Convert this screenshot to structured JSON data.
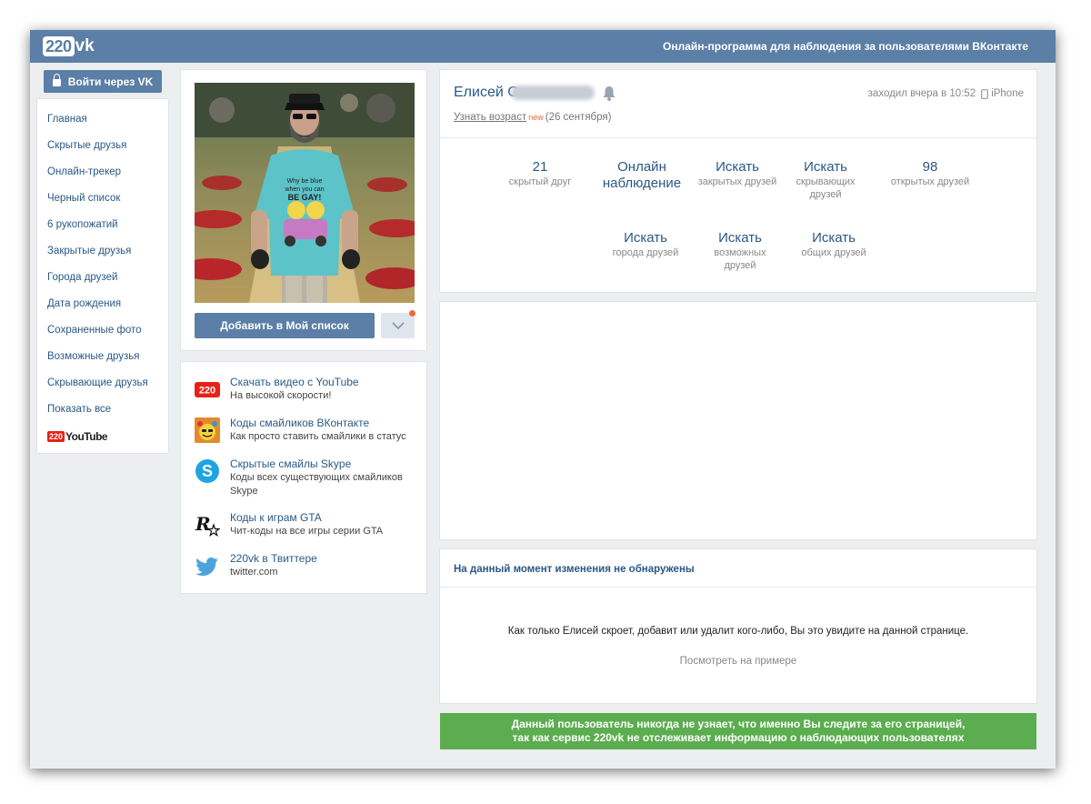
{
  "header": {
    "logo_num": "220",
    "logo_text": "vk",
    "tagline": "Онлайн-программа для наблюдения за пользователями ВКонтакте"
  },
  "login": {
    "label": "Войти через VK"
  },
  "menu": {
    "items": [
      "Главная",
      "Скрытые друзья",
      "Онлайн-трекер",
      "Черный список",
      "6 рукопожатий",
      "Закрытые друзья",
      "Города друзей",
      "Дата рождения",
      "Сохраненные фото",
      "Возможные друзья",
      "Скрывающие друзья",
      "Показать все"
    ],
    "youtube": {
      "num": "220",
      "text": "YouTube"
    }
  },
  "photo_panel": {
    "add_label": "Добавить в Мой список",
    "shirt_text_1": "Why be blue",
    "shirt_text_2": "when you can",
    "shirt_text_3": "BE GAY!"
  },
  "links": [
    {
      "icon": "youtube-220-icon",
      "badge": "220",
      "title": "Скачать видео с YouTube",
      "sub": "На высокой скорости!"
    },
    {
      "icon": "emoji-icon",
      "title": "Коды смайликов ВКонтакте",
      "sub": "Как просто ставить смайлики в статус"
    },
    {
      "icon": "skype-icon",
      "title": "Скрытые смайлы Skype",
      "sub": "Коды всех существующих смайликов Skype"
    },
    {
      "icon": "rockstar-icon",
      "title": "Коды к играм GTA",
      "sub": "Чит-коды на все игры серии GTA"
    },
    {
      "icon": "twitter-icon",
      "title": "220vk в Твиттере",
      "sub": "twitter.com"
    }
  ],
  "profile": {
    "first_name": "Елисей",
    "initial": "С",
    "last_seen": "заходил вчера в 10:52",
    "device": "iPhone",
    "age_link": "Узнать возраст",
    "age_new": "new",
    "birthday": "(26 сентября)",
    "stats_row1": [
      {
        "main": "21",
        "sub": "скрытый друг"
      },
      {
        "main": "Онлайн наблюдение",
        "sub": ""
      },
      {
        "main": "Искать",
        "sub": "закрытых друзей"
      },
      {
        "main": "Искать",
        "sub": "скрывающих друзей"
      },
      {
        "main": "98",
        "sub": "открытых друзей"
      }
    ],
    "stats_row2": [
      {
        "main": "Искать",
        "sub": "города друзей"
      },
      {
        "main": "Искать",
        "sub": "возможных друзей"
      },
      {
        "main": "Искать",
        "sub": "общих друзей"
      }
    ]
  },
  "changes": {
    "title": "На данный момент изменения не обнаружены",
    "text": "Как только Елисей скроет, добавит или удалит кого-либо, Вы это увидите на данной странице.",
    "link": "Посмотреть на примере"
  },
  "banner": {
    "line1": "Данный пользователь никогда не узнает, что именно Вы следите за его страницей,",
    "line2": "так как сервис 220vk не отслеживает информацию о наблюдающих пользователях"
  },
  "colors": {
    "accent": "#5b7fa6",
    "link": "#2a5885",
    "green": "#5bad4f",
    "new": "#e46b3d"
  }
}
